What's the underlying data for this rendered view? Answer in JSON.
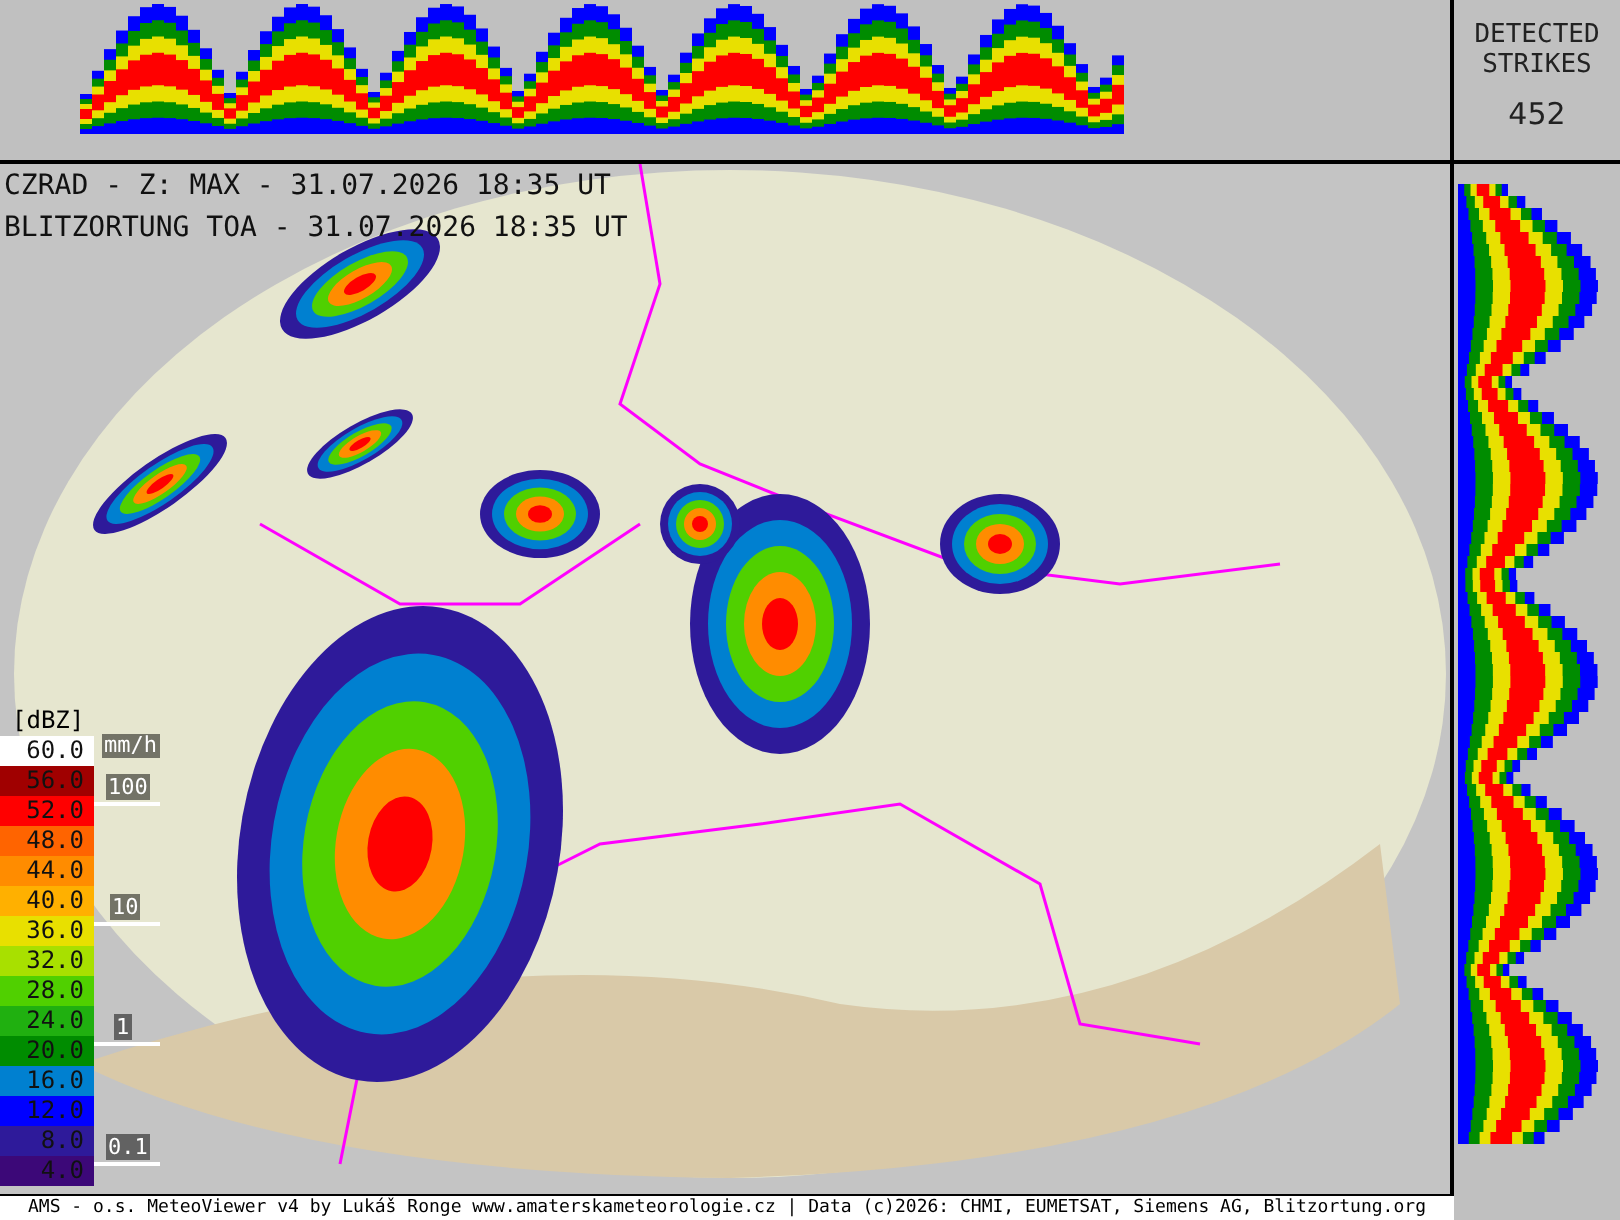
{
  "header_lines": [
    "CZRAD - Z: MAX - 31.07.2026 18:35 UT",
    "BLITZORTUNG TOA - 31.07.2026 18:35 UT"
  ],
  "strikes": {
    "title": "DETECTED STRIKES",
    "count": "452"
  },
  "legend": {
    "unit": "[dBZ]",
    "entries": [
      {
        "label": "60.0",
        "color": "#ffffff"
      },
      {
        "label": "56.0",
        "color": "#a00000"
      },
      {
        "label": "52.0",
        "color": "#ff0000"
      },
      {
        "label": "48.0",
        "color": "#ff6400"
      },
      {
        "label": "44.0",
        "color": "#ff8c00"
      },
      {
        "label": "40.0",
        "color": "#ffb000"
      },
      {
        "label": "36.0",
        "color": "#e8e000"
      },
      {
        "label": "32.0",
        "color": "#a8e000"
      },
      {
        "label": "28.0",
        "color": "#50d000"
      },
      {
        "label": "24.0",
        "color": "#20b010"
      },
      {
        "label": "20.0",
        "color": "#008c00"
      },
      {
        "label": "16.0",
        "color": "#0080d0"
      },
      {
        "label": "12.0",
        "color": "#0000ff"
      },
      {
        "label": "8.0",
        "color": "#2e1a9a"
      },
      {
        "label": "4.0",
        "color": "#3c0878"
      }
    ]
  },
  "rain_scale": {
    "unit": "mm/h",
    "ticks": [
      "100",
      "10",
      "1",
      "0.1"
    ]
  },
  "footer": "AMS - o.s. MeteoViewer v4 by Lukáš Ronge www.amaterskameteorologie.cz | Data (c)2026: CHMI, EUMETSAT, Siemens AG, Blitzortung.org"
}
